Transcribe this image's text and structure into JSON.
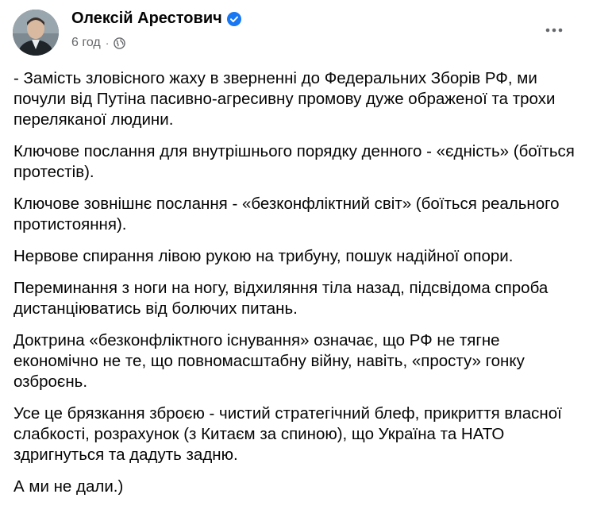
{
  "post": {
    "author": "Олексій Арестович",
    "time": "6 год",
    "meta_separator": "·",
    "icons": {
      "verified": "verified-badge-icon",
      "audience": "globe-icon",
      "more": "more-dots-icon"
    },
    "colors": {
      "verified": "#1877f2",
      "meta": "#65676b",
      "text": "#050505"
    },
    "paragraphs": [
      "- Замість зловісного жаху в зверненні до Федеральних Зборів РФ, ми почули від Путіна пасивно-агресивну промову дуже ображеної та трохи переляканої людини.",
      "Ключове послання для внутрішнього порядку денного - «єдність» (боїться протестів).",
      "Ключове зовнішнє послання - «безконфліктний світ» (боїться реального протистояння).",
      "Нервове спирання лівою рукою на трибуну, пошук надійної опори.",
      "Переминання з ноги на ногу, відхиляння тіла назад, підсвідома спроба дистанціюватись від болючих питань.",
      "Доктрина «безконфліктного існування» означає, що РФ не тягне економічно не те, що повномасштабну війну, навіть, «просту» гонку озброєнь.",
      "Усе це брязкання зброєю - чистий стратегічний блеф, прикриття власної слабкості, розрахунок (з Китаєм за спиною), що Україна та НАТО здригнуться та дадуть задню.",
      "А ми не дали.)"
    ]
  }
}
